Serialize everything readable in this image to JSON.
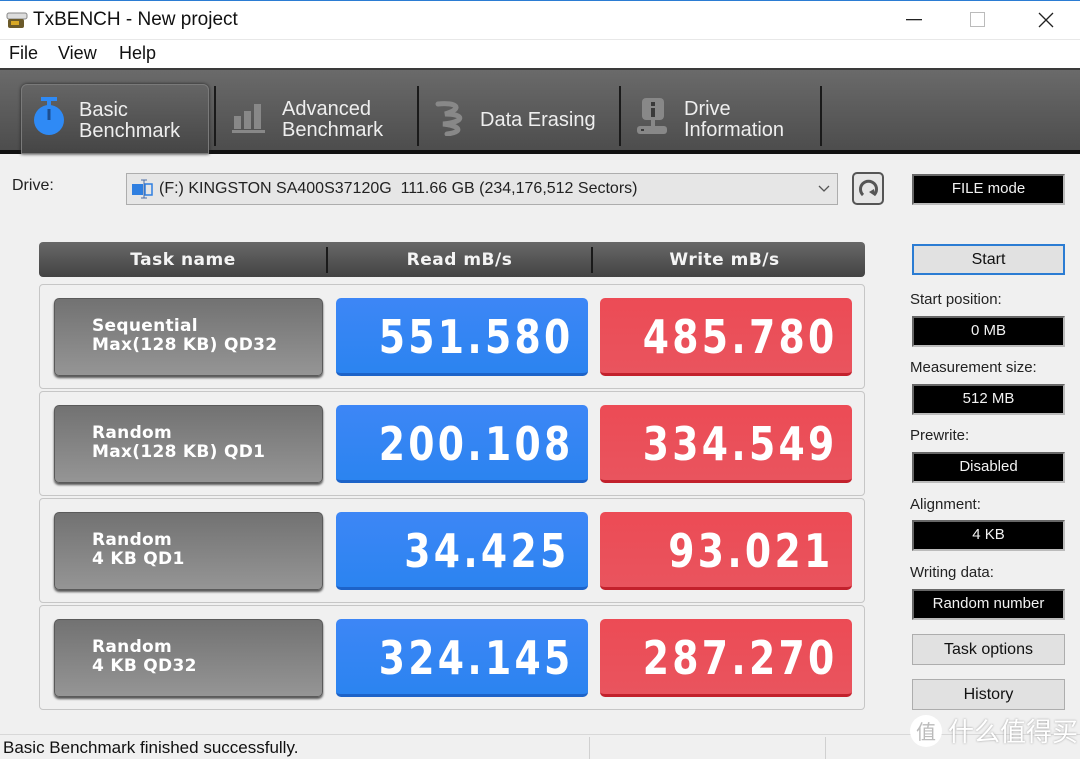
{
  "window": {
    "title": "TxBENCH - New project",
    "controls": {
      "minimize": "minimize-icon",
      "maximize": "maximize-icon",
      "close": "close-icon"
    }
  },
  "menu": [
    "File",
    "View",
    "Help"
  ],
  "tabs": [
    {
      "label": "Basic\nBenchmark",
      "icon": "stopwatch-icon",
      "active": true
    },
    {
      "label": "Advanced\nBenchmark",
      "icon": "bar-chart-icon",
      "active": false
    },
    {
      "label": "Data Erasing",
      "icon": "eraser-icon",
      "active": false
    },
    {
      "label": "Drive\nInformation",
      "icon": "drive-info-icon",
      "active": false
    }
  ],
  "drive": {
    "label": "Drive:",
    "selected": "(F:) KINGSTON SA400S37120G  111.66 GB (234,176,512 Sectors)",
    "mode": "FILE mode"
  },
  "table": {
    "headers": [
      "Task name",
      "Read mB/s",
      "Write mB/s"
    ],
    "rows": [
      {
        "task": "Sequential\nMax(128 KB) QD32",
        "read": "551.580",
        "write": "485.780"
      },
      {
        "task": "Random\nMax(128 KB) QD1",
        "read": "200.108",
        "write": "334.549"
      },
      {
        "task": "Random\n4 KB QD1",
        "read": "34.425",
        "write": "93.021"
      },
      {
        "task": "Random\n4 KB QD32",
        "read": "324.145",
        "write": "287.270"
      }
    ]
  },
  "side": {
    "start": "Start",
    "start_position_label": "Start position:",
    "start_position": "0 MB",
    "measurement_size_label": "Measurement size:",
    "measurement_size": "512 MB",
    "prewrite_label": "Prewrite:",
    "prewrite": "Disabled",
    "alignment_label": "Alignment:",
    "alignment": "4 KB",
    "writing_data_label": "Writing data:",
    "writing_data": "Random number",
    "task_options": "Task options",
    "history": "History"
  },
  "status": "Basic Benchmark finished successfully.",
  "watermark": {
    "badge": "值",
    "text": "什么值得买"
  },
  "colors": {
    "read": "#3d86f6",
    "write": "#ec4b55",
    "accent": "#2b7cd3"
  }
}
